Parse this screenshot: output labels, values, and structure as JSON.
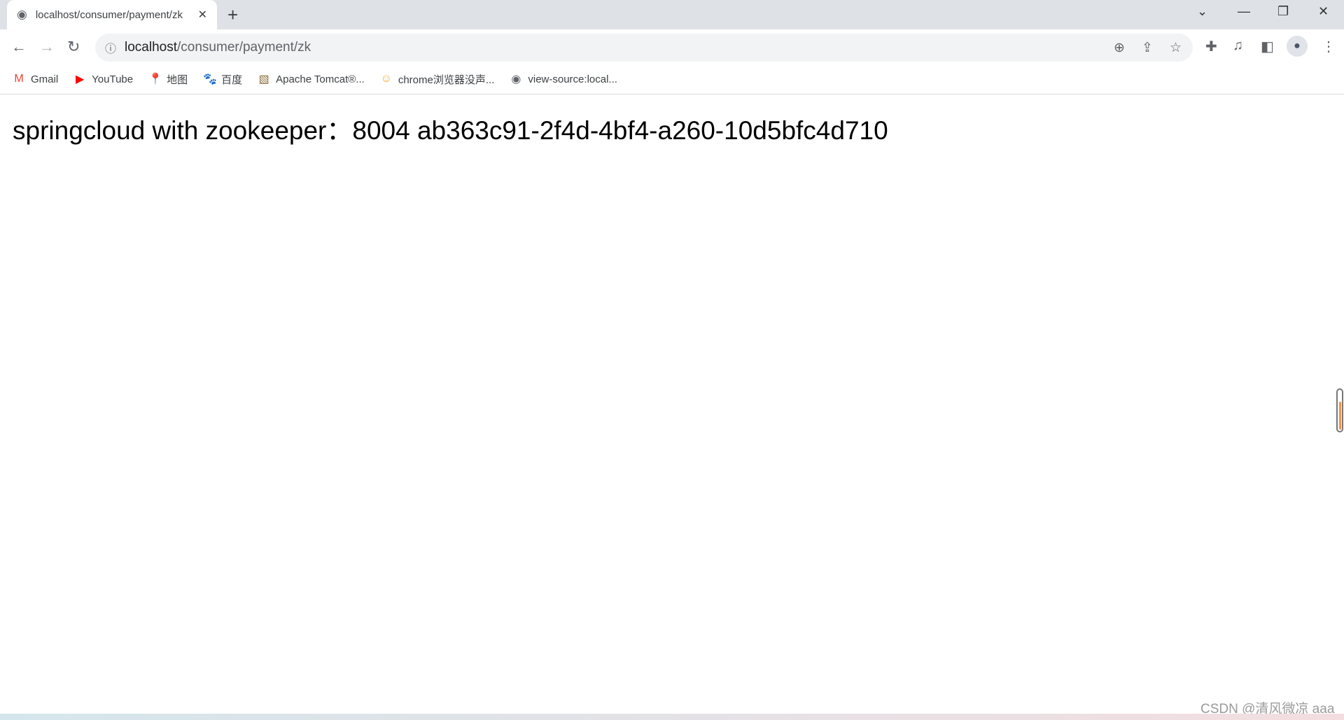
{
  "tab": {
    "title": "localhost/consumer/payment/zk",
    "icon": "globe-icon"
  },
  "address": {
    "host": "localhost",
    "path": "/consumer/payment/zk"
  },
  "bookmarks": [
    {
      "label": "Gmail",
      "icon": "gmail-icon",
      "color": "#ea4335"
    },
    {
      "label": "YouTube",
      "icon": "youtube-icon",
      "color": "#ff0000"
    },
    {
      "label": "地图",
      "icon": "maps-icon",
      "color": "#34a853"
    },
    {
      "label": "百度",
      "icon": "baidu-icon",
      "color": "#2932e1"
    },
    {
      "label": "Apache Tomcat®...",
      "icon": "tomcat-icon",
      "color": "#8a6d3b"
    },
    {
      "label": "chrome浏览器没声...",
      "icon": "smiley-icon",
      "color": "#f5a623"
    },
    {
      "label": "view-source:local...",
      "icon": "globe-icon",
      "color": "#5f6368"
    }
  ],
  "page": {
    "text": "springcloud with zookeeper：8004 ab363c91-2f4d-4bf4-a260-10d5bfc4d710"
  },
  "watermark": "CSDN @清风微凉 aaa"
}
